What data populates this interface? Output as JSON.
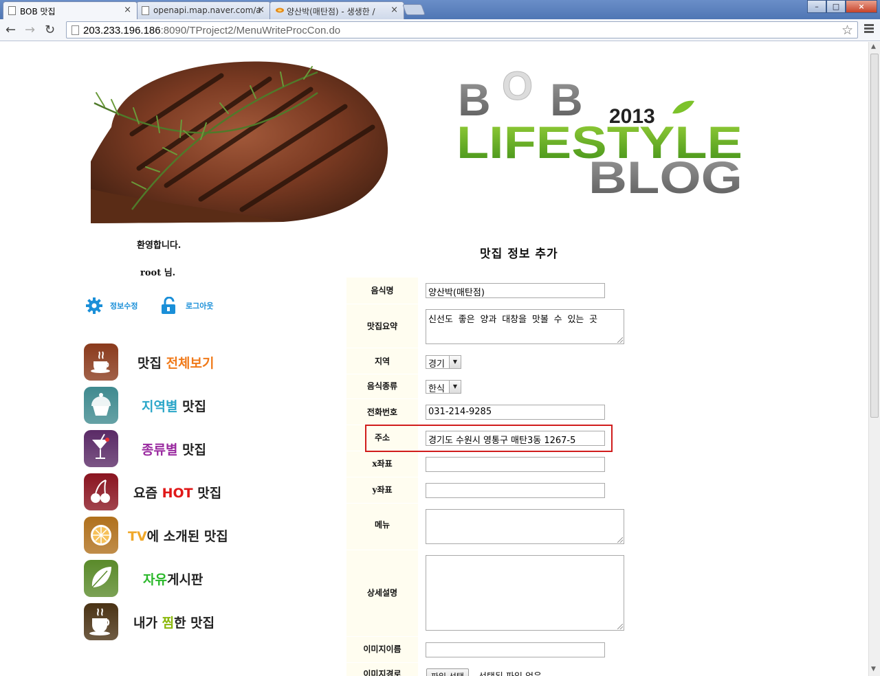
{
  "browser": {
    "tabs": [
      {
        "title": "BOB 맛집",
        "active": true
      },
      {
        "title": "openapi.map.naver.com/a",
        "active": false
      },
      {
        "title": "양산박(매탄점) - 생생한 /",
        "active": false
      }
    ],
    "tab_close": "×",
    "url_host": "203.233.196.186",
    "url_rest": ":8090/TProject2/MenuWriteProcCon.do",
    "window_controls": [
      "–",
      "□",
      "×"
    ]
  },
  "logo": {
    "letters": [
      "B",
      "O",
      "B"
    ],
    "year": "2013",
    "word1": "LIFESTYLE",
    "word2": "BLOG"
  },
  "sidebar": {
    "welcome": "환영합니다.",
    "user": "root 님.",
    "edit_info": "정보수정",
    "logout": "로그아웃",
    "menu": [
      {
        "prefix": "맛집 ",
        "accent": "전체보기",
        "suffix": "",
        "accent_color": "#f07a1a",
        "icon": "coffee-cup-icon",
        "icon_color": "#8a3a1c"
      },
      {
        "prefix": "",
        "accent": "지역별",
        "suffix": " 맛집",
        "accent_color": "#2aa6c8",
        "icon": "cupcake-icon",
        "icon_color": "#3f8a8f"
      },
      {
        "prefix": "",
        "accent": "종류별",
        "suffix": " 맛집",
        "accent_color": "#9a2aa0",
        "icon": "cocktail-icon",
        "icon_color": "#5a2a66"
      },
      {
        "prefix": "요즘 ",
        "accent": "HOT",
        "suffix": " 맛집",
        "accent_color": "#e01818",
        "icon": "cherry-icon",
        "icon_color": "#8a1420"
      },
      {
        "prefix": "",
        "accent": "TV",
        "suffix": "에 소개된 맛집",
        "accent_color": "#f0a82a",
        "icon": "orange-slice-icon",
        "icon_color": "#b0701c"
      },
      {
        "prefix": "",
        "accent": "자유",
        "suffix": "게시판",
        "accent_color": "#2ab82a",
        "icon": "leaf-icon",
        "icon_color": "#5a8a2a"
      },
      {
        "prefix": "내가 ",
        "accent": "찜",
        "suffix": "한 맛집",
        "accent_color": "#8ab80a",
        "icon": "coffee-mug-icon",
        "icon_color": "#4a3214"
      }
    ]
  },
  "form": {
    "title": "맛집 정보 추가",
    "fields": {
      "name": {
        "label": "음식명",
        "value": "양산박(매탄점)"
      },
      "summary": {
        "label": "맛집요약",
        "value": "신선도 좋은 양과 대창을 맛볼 수 있는 곳"
      },
      "region": {
        "label": "지역",
        "value": "경기"
      },
      "food_type": {
        "label": "음식종류",
        "value": "한식"
      },
      "phone": {
        "label": "전화번호",
        "value": "031-214-9285"
      },
      "address": {
        "label": "주소",
        "value": "경기도 수원시 영통구 매탄3동 1267-5"
      },
      "x_coord": {
        "label": "x좌표",
        "value": ""
      },
      "y_coord": {
        "label": "y좌표",
        "value": ""
      },
      "menu": {
        "label": "메뉴",
        "value": ""
      },
      "detail": {
        "label": "상세설명",
        "value": ""
      },
      "image_name": {
        "label": "이미지이름",
        "value": ""
      },
      "image_path": {
        "label": "이미지경로",
        "button": "파일 선택",
        "status": "선택된 파일 없음"
      }
    }
  },
  "colors": {
    "highlight": "#d01c1c",
    "label_bg": "#fffdf0",
    "link_blue": "#1a8fd8"
  }
}
